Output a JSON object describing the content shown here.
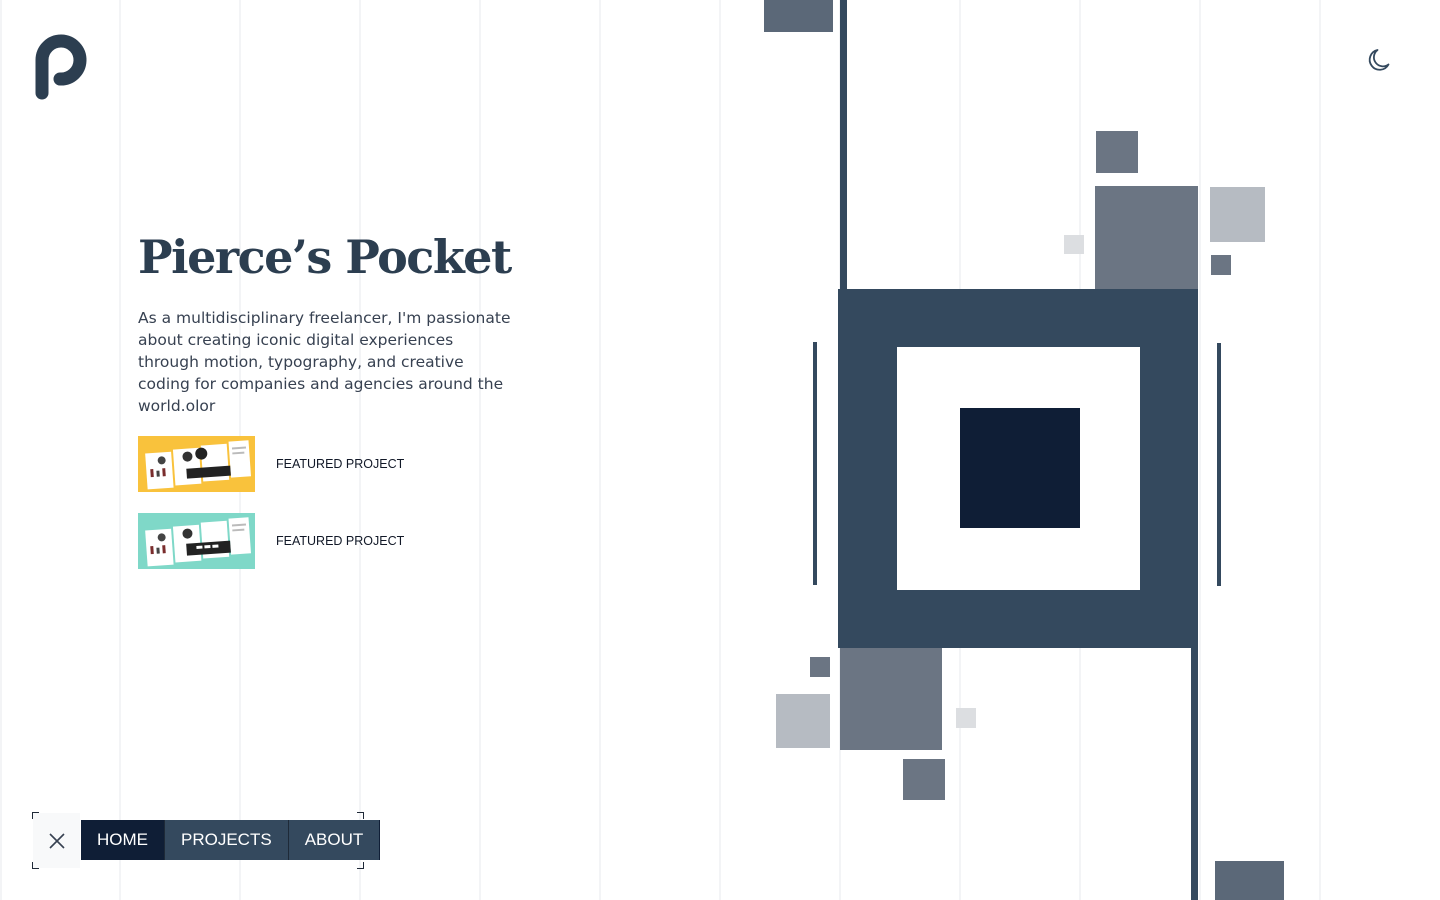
{
  "site": {
    "logo_icon": "p-logo-icon",
    "theme_toggle_icon": "moon-icon"
  },
  "hero": {
    "title": "Pierce’s Pocket",
    "description": "As a multidisciplinary freelancer, I'm passionate about creating iconic digital experiences through motion, typography, and creative coding for companies and agencies around the world.olor"
  },
  "projects": [
    {
      "label": "FEATURED PROJECT",
      "thumb_color": "#f9c23c"
    },
    {
      "label": "FEATURED PROJECT",
      "thumb_color": "#7fd8c8"
    }
  ],
  "nav": {
    "close_icon": "close-icon",
    "items": [
      {
        "label": "HOME",
        "active": true
      },
      {
        "label": "PROJECTS",
        "active": false
      },
      {
        "label": "ABOUT",
        "active": false
      }
    ]
  },
  "colors": {
    "primary": "#34495e",
    "dark": "#0f1e36",
    "slate": "#6b7583",
    "light_slate": "#b6bbc2",
    "pale": "#dcdee1",
    "text": "#2c3e50"
  }
}
